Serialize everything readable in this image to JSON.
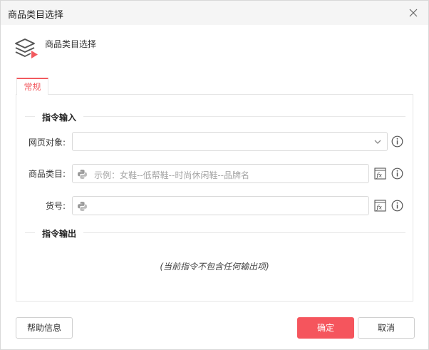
{
  "window": {
    "title": "商品类目选择"
  },
  "header": {
    "title": "商品类目选择",
    "icon": "layers-play-icon"
  },
  "tabs": [
    {
      "label": "常规",
      "active": true
    }
  ],
  "sections": {
    "input": {
      "label": "指令输入"
    },
    "output": {
      "label": "指令输出",
      "empty_text": "(当前指令不包含任何输出项)"
    }
  },
  "fields": {
    "web_object": {
      "label": "网页对象:",
      "value": ""
    },
    "category": {
      "label": "商品类目:",
      "placeholder": "示例：女鞋--低帮鞋--时尚休闲鞋--品牌名",
      "value": ""
    },
    "item_no": {
      "label": "货号:",
      "value": ""
    }
  },
  "buttons": {
    "help": "帮助信息",
    "ok": "确定",
    "cancel": "取消"
  },
  "colors": {
    "accent": "#f5555d",
    "border": "#d9d9d9",
    "titlebar": "#f5f5f5"
  }
}
